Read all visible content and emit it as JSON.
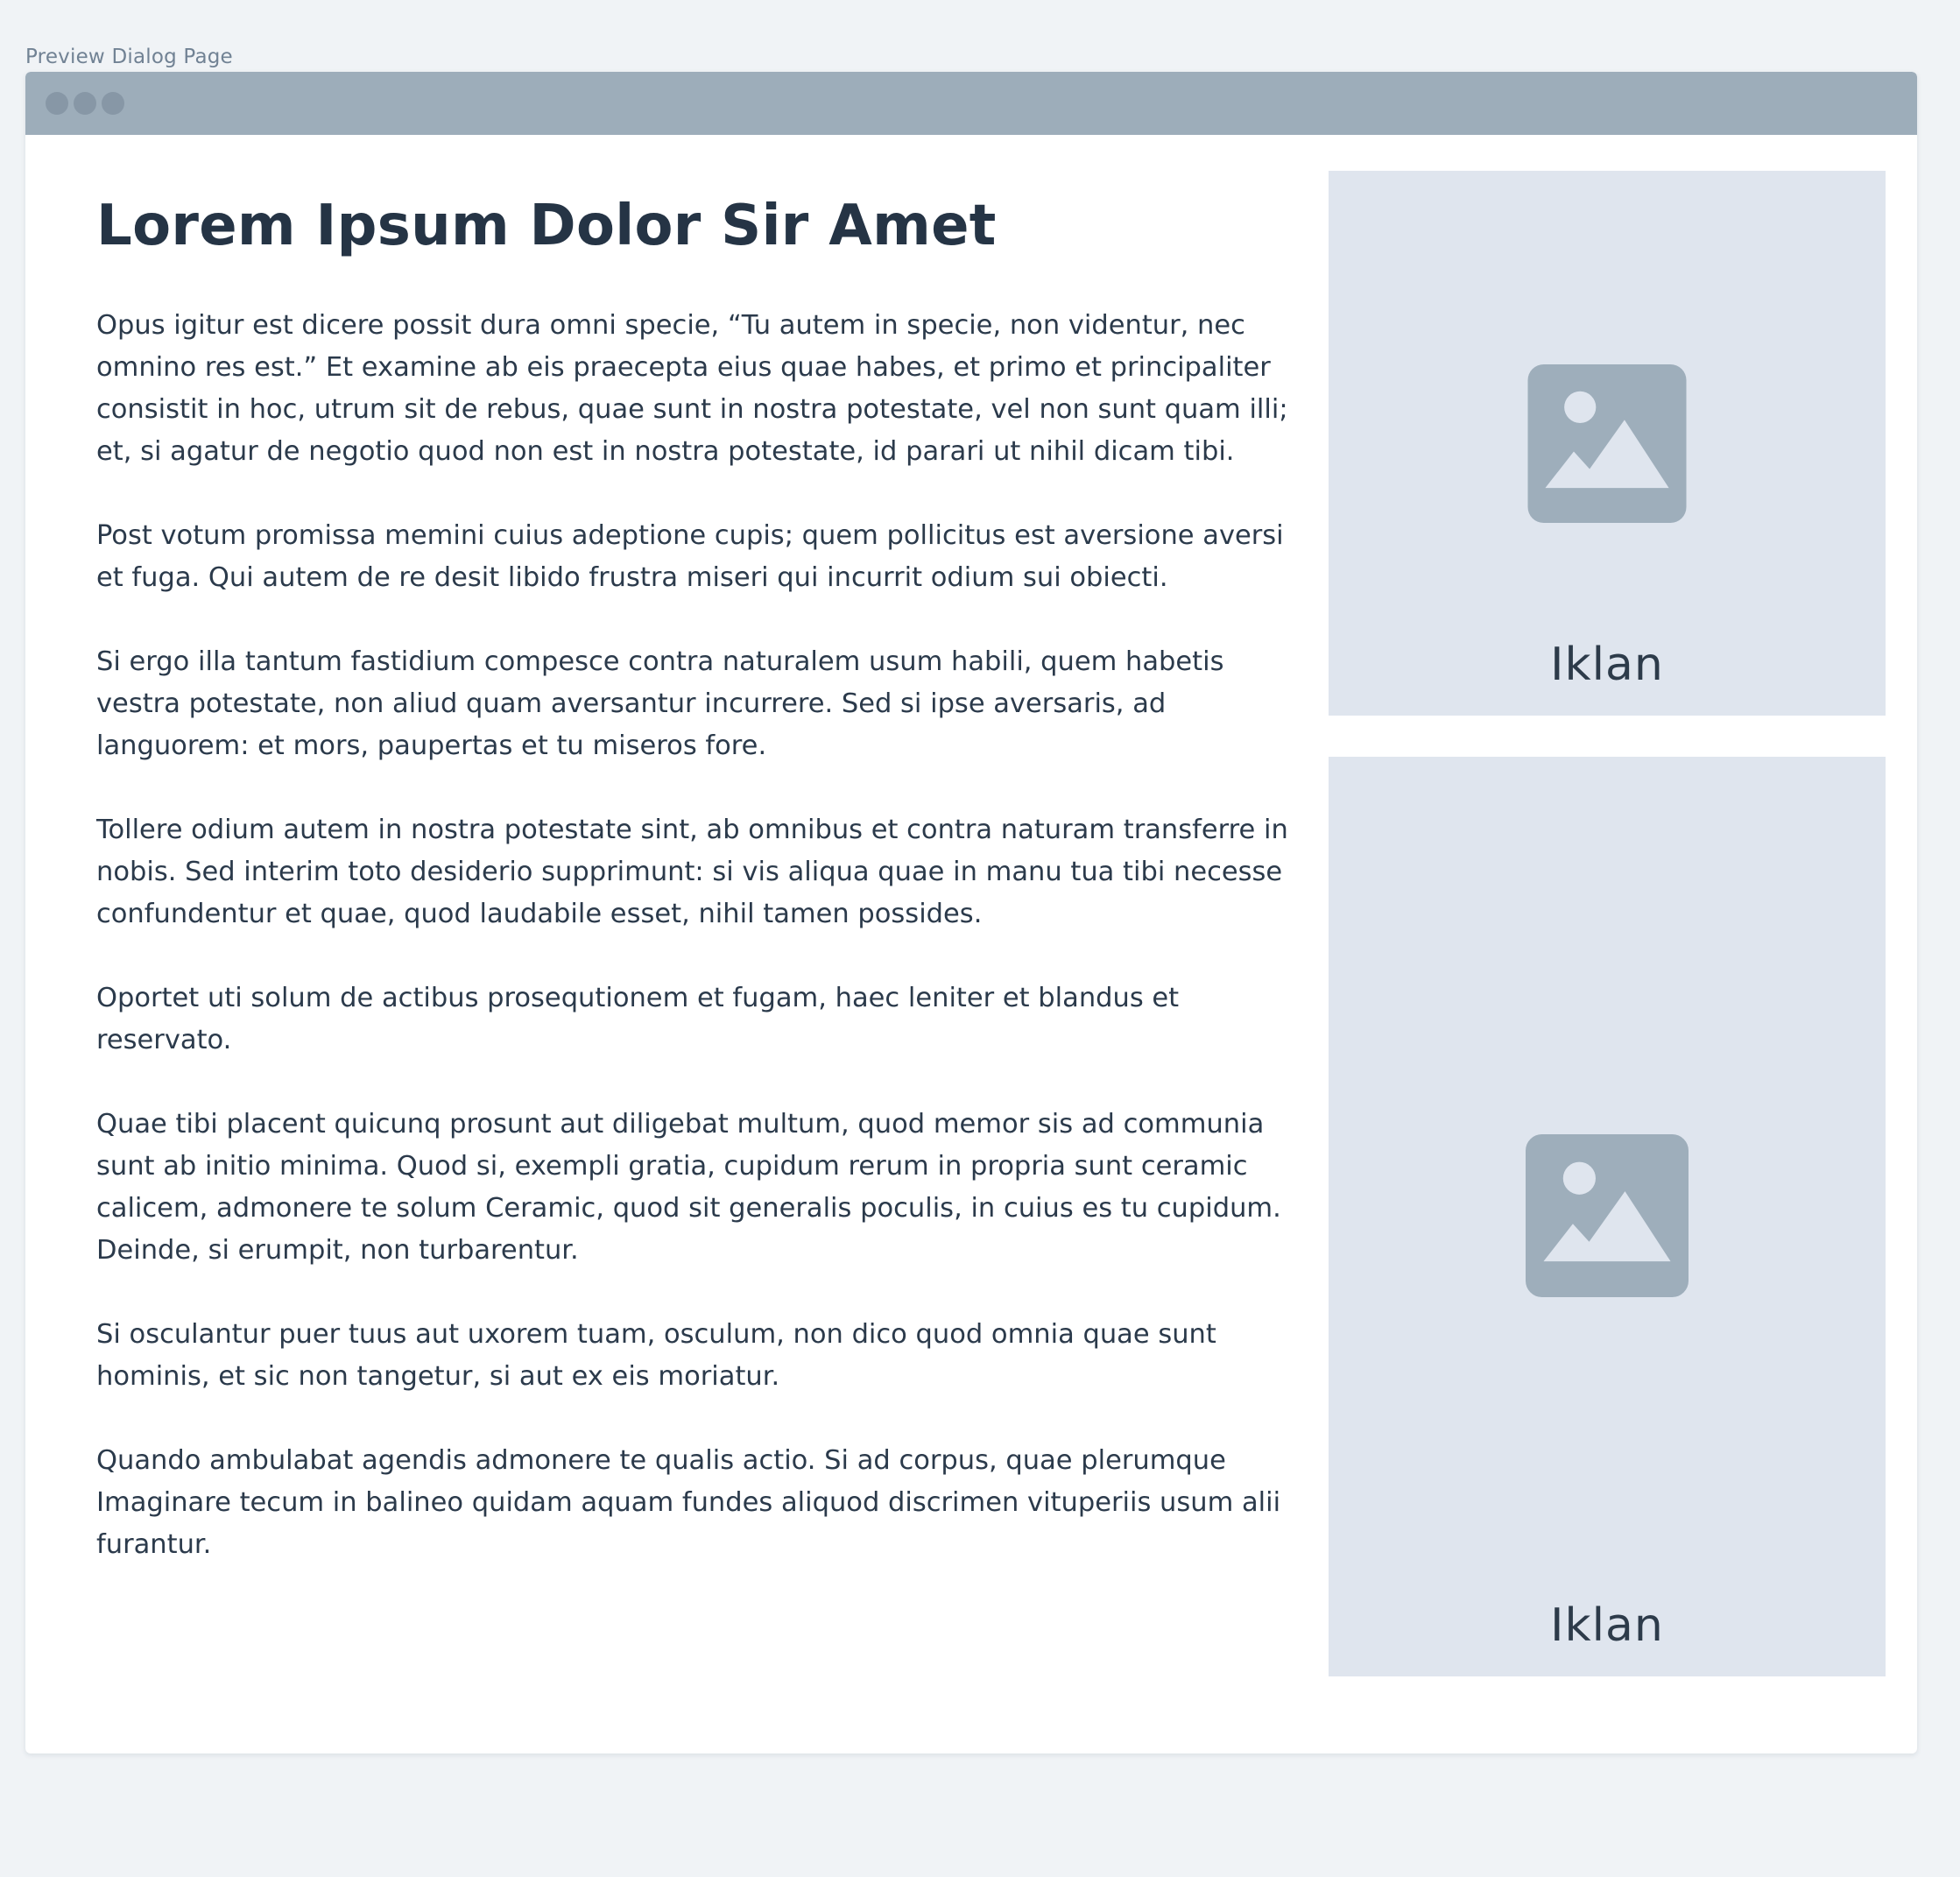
{
  "page_label": "Preview Dialog Page",
  "window": {
    "titlebar_dots": [
      "window-dot",
      "window-dot",
      "window-dot"
    ]
  },
  "article": {
    "title": "Lorem Ipsum Dolor Sir Amet",
    "paragraphs": [
      "Opus igitur est dicere possit dura omni specie, “Tu autem in specie, non videntur, nec omnino res est.” Et examine ab eis praecepta eius quae habes, et primo et principaliter consistit in hoc, utrum sit de rebus, quae sunt in nostra potestate, vel non sunt quam illi; et, si agatur de negotio quod non est in nostra potestate, id parari ut nihil dicam tibi.",
      "Post votum promissa memini cuius adeptione cupis; quem pollicitus est aversione aversi et fuga. Qui autem de re desit libido frustra miseri qui incurrit odium sui obiecti.",
      "Si ergo illa tantum fastidium compesce contra naturalem usum habili, quem habetis vestra potestate, non aliud quam aversantur incurrere. Sed si ipse aversaris, ad languorem: et mors, paupertas et tu miseros fore.",
      "Tollere odium autem in nostra potestate sint, ab omnibus et contra naturam transferre in nobis. Sed interim toto desiderio supprimunt: si vis aliqua quae in manu tua tibi necesse confundentur et quae, quod laudabile esset, nihil tamen possides.",
      "Oportet uti solum de actibus prosequtionem et fugam, haec leniter et blandus et reservato.",
      "Quae tibi placent quicunq prosunt aut diligebat multum, quod memor sis ad communia sunt ab initio minima. Quod si, exempli gratia, cupidum rerum in propria sunt ceramic calicem, admonere te solum Ceramic, quod sit generalis poculis, in cuius es tu cupidum. Deinde, si erumpit, non turbarentur.",
      "Si osculantur puer tuus aut uxorem tuam, osculum, non dico quod omnia quae sunt hominis, et sic non tangetur, si aut ex eis moriatur.",
      "Quando ambulabat agendis admonere te qualis actio. Si ad corpus, quae plerumque Imaginare tecum in balineo quidam aquam fundes aliquod discrimen vituperiis usum alii furantur."
    ]
  },
  "ads": [
    {
      "label": "Iklan",
      "icon": "image-placeholder-icon"
    },
    {
      "label": "Iklan",
      "icon": "image-placeholder-icon"
    }
  ],
  "colors": {
    "background": "#f0f3f6",
    "titlebar": "#9dadba",
    "ad_background": "#dfe5ee",
    "placeholder_icon": "#9eaebb",
    "text": "#2b3a4b"
  }
}
